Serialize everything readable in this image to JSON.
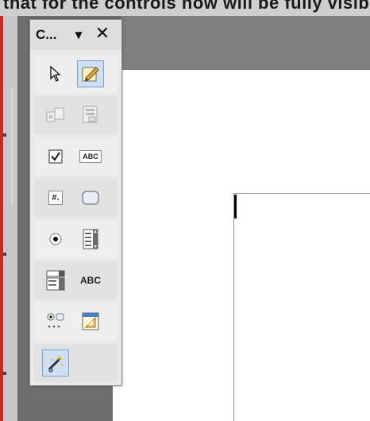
{
  "top_strip": {
    "text": "that for the controls now will be fully visible rs controls"
  },
  "toolbar": {
    "title": "C...",
    "menu_glyph": "▼",
    "close_glyph": "✕",
    "buttons": [
      {
        "name": "select-pointer",
        "icon": "pointer-arrow-icon",
        "pressed": false
      },
      {
        "name": "design-mode",
        "icon": "design-mode-icon",
        "pressed": true
      },
      {
        "name": "control-properties",
        "icon": "control-properties-icon",
        "disabled": true
      },
      {
        "name": "form-properties",
        "icon": "form-properties-icon",
        "disabled": true
      },
      {
        "name": "check-box",
        "icon": "checkbox-icon"
      },
      {
        "name": "text-box",
        "icon": "text-box-icon",
        "label": "ABC"
      },
      {
        "name": "formatted-field",
        "icon": "formatted-field-icon",
        "label": "#."
      },
      {
        "name": "push-button",
        "icon": "push-button-icon"
      },
      {
        "name": "option-button",
        "icon": "radio-button-icon"
      },
      {
        "name": "list-box",
        "icon": "list-box-icon"
      },
      {
        "name": "combo-box",
        "icon": "combo-box-icon"
      },
      {
        "name": "label-field",
        "icon": "label-field-icon",
        "label": "ABC"
      },
      {
        "name": "more-controls",
        "icon": "more-controls-icon"
      },
      {
        "name": "form-design",
        "icon": "form-design-icon"
      },
      {
        "name": "wizards-on-off",
        "icon": "wizard-wand-icon",
        "pressed": true
      }
    ]
  },
  "colors": {
    "frame_red": "#d32222",
    "pressed_bg": "#cfe0f5",
    "workspace_gray": "#7f7f7f"
  }
}
